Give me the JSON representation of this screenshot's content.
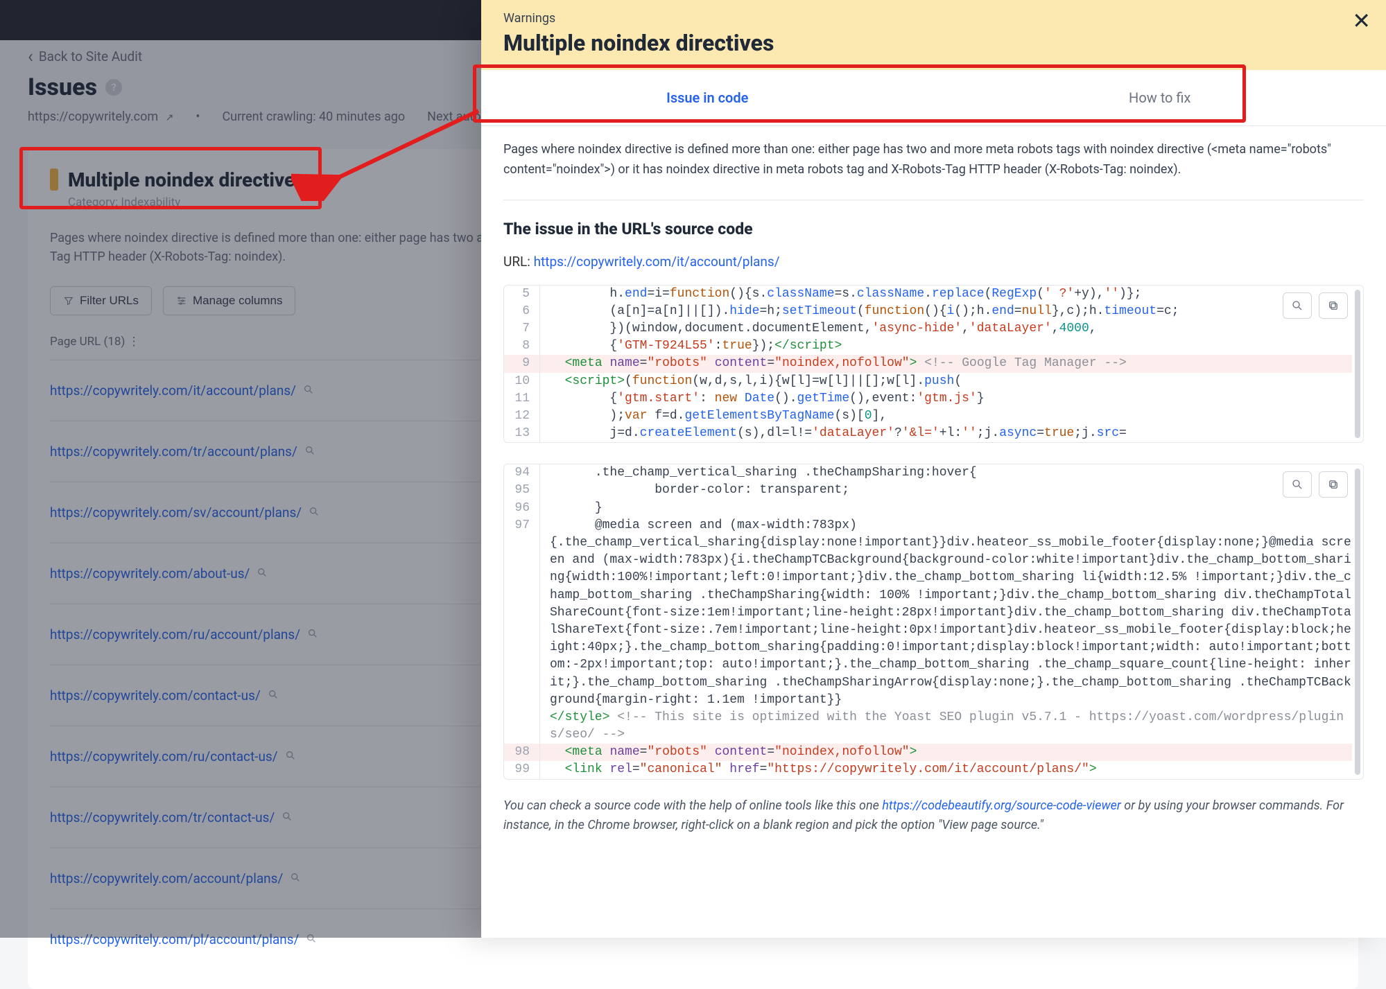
{
  "nav": {
    "back": "Back to Site Audit"
  },
  "issues": {
    "title": "Issues",
    "site": "https://copywritely.com",
    "current_crawl": "Current crawling: 40 minutes ago",
    "next_crawl": "Next autocrawling"
  },
  "card": {
    "title": "Multiple noindex directives",
    "category": "Category: Indexability",
    "desc": "Pages where noindex directive is defined more than one: either page has two and more meta robots tags with noindex directive (<meta name=\"robots\" content=\"noindex\">) or it has noindex directive in meta robots tag and X-Robots-Tag HTTP header (X-Robots-Tag: noindex)."
  },
  "buttons": {
    "filter": "Filter URLs",
    "columns": "Manage columns"
  },
  "table": {
    "header": "Page URL (18)",
    "rows": [
      "https://copywritely.com/it/account/plans/",
      "https://copywritely.com/tr/account/plans/",
      "https://copywritely.com/sv/account/plans/",
      "https://copywritely.com/about-us/",
      "https://copywritely.com/ru/account/plans/",
      "https://copywritely.com/contact-us/",
      "https://copywritely.com/ru/contact-us/",
      "https://copywritely.com/tr/contact-us/",
      "https://copywritely.com/account/plans/",
      "https://copywritely.com/pl/account/plans/"
    ]
  },
  "panel": {
    "kicker": "Warnings",
    "title": "Multiple noindex directives",
    "tab1": "Issue in code",
    "tab2": "How to fix",
    "lead": "Pages where noindex directive is defined more than one: either page has two and more meta robots tags with noindex directive (<meta name=\"robots\" content=\"noindex\">) or it has noindex directive in meta robots tag and X-Robots-Tag HTTP header (X-Robots-Tag: noindex).",
    "section_title": "The issue in the URL's source code",
    "url_label": "URL:",
    "url": "https://copywritely.com/it/account/plans/",
    "code1": [
      {
        "n": 5,
        "html": "        h.<span class='tok-fn'>end</span>=i=<span class='tok-kw'>function</span>(){s.<span class='tok-fn'>className</span>=s.<span class='tok-fn'>className</span>.<span class='tok-fn'>replace</span>(<span class='tok-fn'>RegExp</span>(<span class='tok-str'>' ?'</span>+y),<span class='tok-str'>''</span>)};"
      },
      {
        "n": 6,
        "html": "        (a[n]=a[n]||[]).<span class='tok-fn'>hide</span>=h;<span class='tok-fn'>setTimeout</span>(<span class='tok-kw'>function</span>(){<span class='tok-fn'>i</span>();h.<span class='tok-fn'>end</span>=<span class='tok-kw'>null</span>},c);h.<span class='tok-fn'>timeout</span>=c;"
      },
      {
        "n": 7,
        "html": "        })(window,document.documentElement,<span class='tok-str'>'async-hide'</span>,<span class='tok-str'>'dataLayer'</span>,<span class='tok-num'>4000</span>,"
      },
      {
        "n": 8,
        "html": "        {<span class='tok-str'>'GTM-T924L55'</span>:<span class='tok-kw'>true</span>});<span class='tok-tag'>&lt;/script&gt;</span>"
      },
      {
        "n": 9,
        "hl": true,
        "html": "  <span class='tok-tag'>&lt;meta</span> <span class='tok-attr'>name</span>=<span class='tok-val'>\"robots\"</span> <span class='tok-attr'>content</span>=<span class='tok-val'>\"noindex,nofollow\"</span><span class='tok-tag'>&gt;</span> <span class='tok-comm'>&lt;!-- Google Tag Manager --&gt;</span>"
      },
      {
        "n": 10,
        "html": "  <span class='tok-tag'>&lt;script&gt;</span>(<span class='tok-kw'>function</span>(w,d,s,l,i){w[l]=w[l]||[];w[l].<span class='tok-fn'>push</span>("
      },
      {
        "n": 11,
        "html": "        {<span class='tok-str'>'gtm.start'</span>: <span class='tok-kw'>new</span> <span class='tok-fn'>Date</span>().<span class='tok-fn'>getTime</span>(),event:<span class='tok-str'>'gtm.js'</span>}"
      },
      {
        "n": 12,
        "html": "        );<span class='tok-kw'>var</span> f=d.<span class='tok-fn'>getElementsByTagName</span>(s)[<span class='tok-num'>0</span>],"
      },
      {
        "n": 13,
        "html": "        j=d.<span class='tok-fn'>createElement</span>(s),dl=l!=<span class='tok-str'>'dataLayer'</span>?<span class='tok-str'>'&amp;l='</span>+l:<span class='tok-str'>''</span>;j.<span class='tok-fn'>async</span>=<span class='tok-kw'>true</span>;j.<span class='tok-fn'>src</span>="
      }
    ],
    "code2": [
      {
        "n": 94,
        "html": "      .the_champ_vertical_sharing .theChampSharing:hover{"
      },
      {
        "n": 95,
        "html": "              border-color: transparent;"
      },
      {
        "n": 96,
        "html": "      }"
      },
      {
        "n": 97,
        "html": "      @media screen and (max-width:783px)<br>{.the_champ_vertical_sharing{display:none!important}}div.heateor_ss_mobile_footer{display:none;}@media screen and (max-width:783px){i.theChampTCBackground{background-color:white!important}div.the_champ_bottom_sharing{width:100%!important;left:0!important;}div.the_champ_bottom_sharing li{width:12.5% !important;}div.the_champ_bottom_sharing .theChampSharing{width: 100% !important;}div.the_champ_bottom_sharing div.theChampTotalShareCount{font-size:1em!important;line-height:28px!important}div.the_champ_bottom_sharing div.theChampTotalShareText{font-size:.7em!important;line-height:0px!important}div.heateor_ss_mobile_footer{display:block;height:40px;}.the_champ_bottom_sharing{padding:0!important;display:block!important;width: auto!important;bottom:-2px!important;top: auto!important;}.the_champ_bottom_sharing .the_champ_square_count{line-height: inherit;}.the_champ_bottom_sharing .theChampSharingArrow{display:none;}.the_champ_bottom_sharing .theChampTCBackground{margin-right: 1.1em !important}}<br><span class='tok-tag'>&lt;/style&gt;</span> <span class='tok-comm'>&lt;!-- This site is optimized with the Yoast SEO plugin v5.7.1 - https://yoast.com/wordpress/plugins/seo/ --&gt;</span>"
      },
      {
        "n": 98,
        "hl": true,
        "html": "  <span class='tok-tag'>&lt;meta</span> <span class='tok-attr'>name</span>=<span class='tok-val'>\"robots\"</span> <span class='tok-attr'>content</span>=<span class='tok-val'>\"noindex,nofollow\"</span><span class='tok-tag'>&gt;</span>"
      },
      {
        "n": 99,
        "html": "  <span class='tok-tag'>&lt;link</span> <span class='tok-attr'>rel</span>=<span class='tok-val'>\"canonical\"</span> <span class='tok-attr'>href</span>=<span class='tok-val'>\"https://copywritely.com/it/account/plans/\"</span><span class='tok-tag'>&gt;</span>"
      }
    ],
    "footer_pre": "You can check a source code with the help of online tools like this one ",
    "footer_link": "https://codebeautify.org/source-code-viewer",
    "footer_post": " or by using your browser commands. For instance, in the Chrome browser, right-click on a blank region and pick the option \"View page source.\""
  }
}
